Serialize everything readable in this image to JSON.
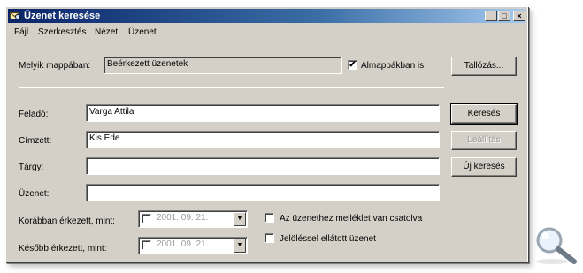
{
  "window": {
    "title": "Üzenet keresése"
  },
  "menu": [
    "Fájl",
    "Szerkesztés",
    "Nézet",
    "Üzenet"
  ],
  "folder": {
    "label": "Melyik mappában:",
    "value": "Beérkezett üzenetek",
    "subfolders_label": "Almappákban is",
    "subfolders_checked": true,
    "browse_button": "Tallózás..."
  },
  "fields": {
    "from_label": "Feladó:",
    "from_value": "Varga Attila",
    "to_label": "Címzett:",
    "to_value": "Kis Ede",
    "subject_label": "Tárgy:",
    "subject_value": "",
    "message_label": "Üzenet:",
    "message_value": ""
  },
  "buttons": {
    "search": "Keresés",
    "stop": "Leállítás",
    "new_search": "Új keresés"
  },
  "dates": {
    "before_label": "Korábban érkezett, mint:",
    "before_value": "2001. 09. 21.",
    "before_checked": false,
    "after_label": "Később érkezett, mint:",
    "after_value": "2001. 09. 21.",
    "after_checked": false
  },
  "options": {
    "attachment_label": "Az üzenethez melléklet van csatolva",
    "attachment_checked": false,
    "flagged_label": "Jelöléssel ellátott üzenet",
    "flagged_checked": false
  },
  "icons": {
    "title_icon": "envelope-search-icon",
    "corner_icon": "magnifier-icon",
    "checked_glyph": "✔",
    "dropdown_glyph": "▼"
  }
}
